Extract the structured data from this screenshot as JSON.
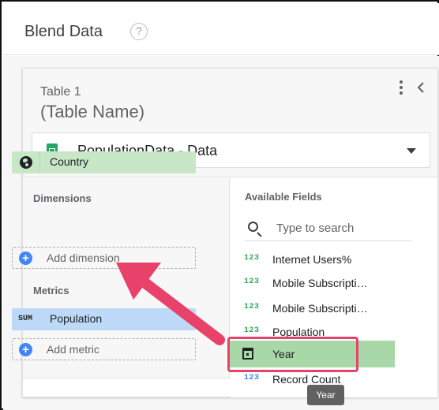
{
  "header": {
    "title": "Blend Data",
    "help_glyph": "?"
  },
  "table": {
    "label": "Table 1",
    "name": "(Table Name)",
    "data_source": "PopulationData - Data"
  },
  "dimensions": {
    "title": "Dimensions",
    "items": [
      {
        "label": "Country",
        "icon": "globe-icon"
      }
    ],
    "add_label": "Add dimension"
  },
  "metrics": {
    "title": "Metrics",
    "items": [
      {
        "label": "Population",
        "badge": "SUM"
      }
    ],
    "add_label": "Add metric"
  },
  "available_fields": {
    "title": "Available Fields",
    "search_placeholder": "Type to search",
    "items": [
      {
        "type": "123",
        "label": "Internet Users%"
      },
      {
        "type": "123",
        "label": "Mobile Subscripti…"
      },
      {
        "type": "123",
        "label": "Mobile Subscripti…"
      },
      {
        "type": "123",
        "label": "Population"
      },
      {
        "type": "calendar-icon",
        "label": "Year"
      },
      {
        "type": "123",
        "label": "Record Count"
      }
    ]
  },
  "tooltip": {
    "text": "Year"
  },
  "colors": {
    "dimension_chip": "#c7e7c7",
    "metric_chip": "#bcdaf7",
    "highlight": "#e8416a",
    "add_icon": "#4285f4",
    "numeric_type": "#34a853",
    "record_count_type": "#4285f4"
  }
}
